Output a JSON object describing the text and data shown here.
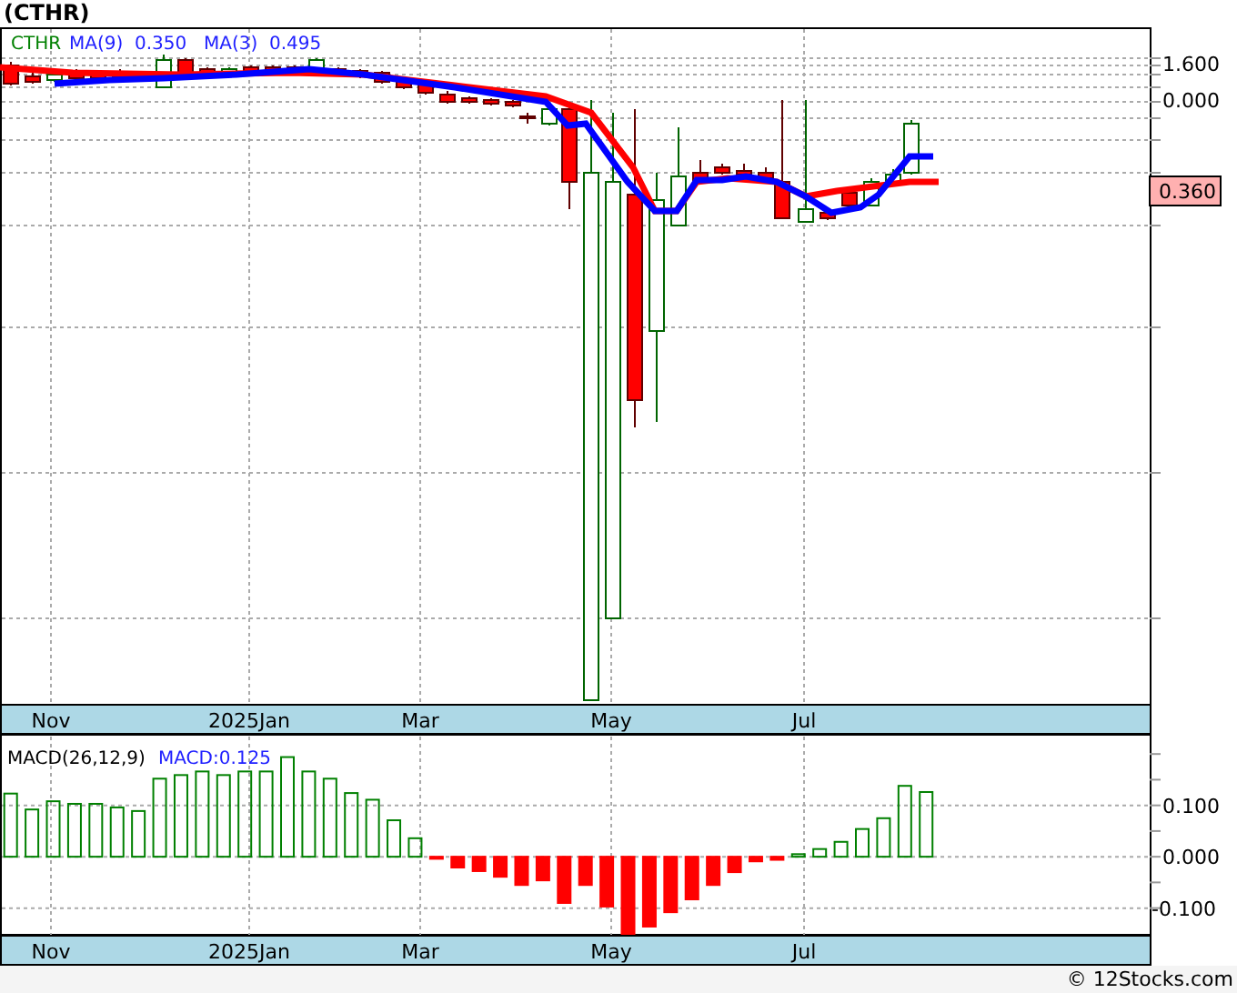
{
  "title": "(CTHR)",
  "price_panel": {
    "legend": [
      {
        "text": "CTHR",
        "color": "#008000"
      },
      {
        "text": "MA(9)",
        "color": "#2020ff"
      },
      {
        "text": "0.350",
        "color": "#2020ff"
      },
      {
        "text": "MA(3)",
        "color": "#2020ff"
      },
      {
        "text": "0.495",
        "color": "#2020ff"
      }
    ],
    "y_axis_labels": [
      "1.600",
      "0.000"
    ],
    "last_price": "0.360",
    "x_axis_labels": [
      "Nov",
      "2025Jan",
      "Mar",
      "May",
      "Jul"
    ]
  },
  "macd_panel": {
    "legend": [
      {
        "text": "MACD(26,12,9)",
        "color": "#000000"
      },
      {
        "text": "MACD:0.125",
        "color": "#2020ff"
      }
    ],
    "chart_data": {
      "type": "bar",
      "grid": true,
      "stacked": true,
      "categories": [
        null,
        null,
        null,
        null,
        null,
        null,
        null,
        null,
        null,
        null,
        null,
        null,
        null,
        null,
        null,
        null,
        null,
        null,
        null,
        null,
        null,
        null,
        null,
        null,
        null,
        null,
        null,
        null,
        null,
        null,
        null,
        null,
        null,
        null,
        null,
        null,
        null,
        null,
        null,
        null,
        null,
        null,
        null,
        null,
        null,
        null,
        null,
        null,
        null,
        null,
        null,
        null,
        null,
        null
      ],
      "ylim": [
        -0.152,
        0.2375
      ],
      "yticks": [
        {
          "value": 0.1,
          "label": "0.100"
        },
        {
          "value": 0,
          "label": "0.000"
        },
        {
          "value": -0.1,
          "label": "-0.100"
        }
      ],
      "series": [
        {
          "color": "#008000",
          "values": [
            0.123,
            0.092,
            0.108,
            0.103,
            0.103,
            0.096,
            0.089,
            0.152,
            0.159,
            0.166,
            0.159,
            0.166,
            0.166,
            0.194,
            0.166,
            0.152,
            0.124,
            0.111,
            0.071,
            0.036,
            null,
            null,
            null,
            null,
            null,
            null,
            null,
            null,
            null,
            null,
            null,
            null,
            null,
            null,
            null,
            null,
            null,
            0.005,
            0.015,
            0.029,
            0.054,
            0.075,
            0.138,
            0.126,
            null,
            null,
            null,
            null,
            null,
            null,
            null,
            null,
            null,
            null
          ]
        },
        {
          "color": "#ff0000",
          "values": [
            null,
            null,
            null,
            null,
            null,
            null,
            null,
            null,
            null,
            null,
            null,
            null,
            null,
            null,
            null,
            null,
            null,
            null,
            null,
            null,
            -0.004,
            -0.021,
            -0.028,
            -0.039,
            -0.055,
            -0.046,
            -0.09,
            -0.055,
            -0.097,
            -0.152,
            -0.136,
            -0.108,
            -0.083,
            -0.055,
            -0.03,
            -0.009,
            -0.006,
            null,
            null,
            null,
            null,
            null,
            null,
            null,
            null,
            null,
            null,
            null,
            null,
            null,
            null,
            null,
            null,
            null
          ]
        }
      ]
    },
    "x_axis_labels": [
      "Nov",
      "2025Jan",
      "Mar",
      "May",
      "Jul"
    ]
  },
  "footer": "© 12Stocks.com"
}
